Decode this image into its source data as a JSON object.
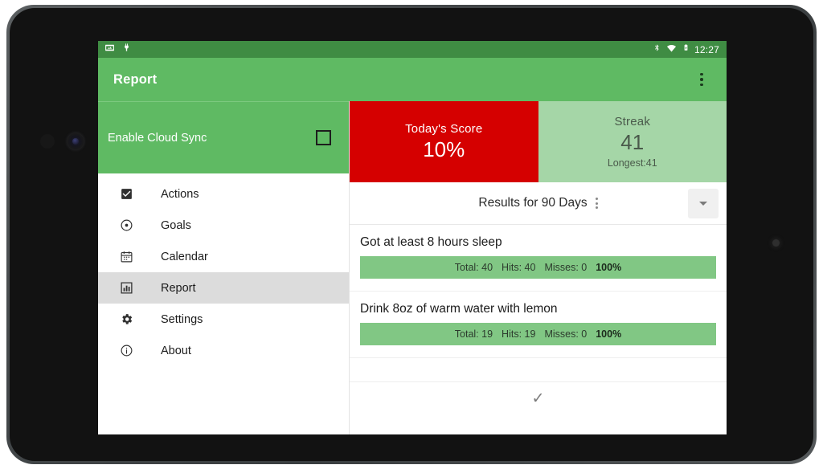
{
  "status_bar": {
    "left_icons": [
      "screenshot-icon",
      "usb-plug-icon"
    ],
    "right_icons": [
      "bluetooth-icon",
      "wifi-icon",
      "battery-charging-icon"
    ],
    "clock": "12:27"
  },
  "app_bar": {
    "title": "Report",
    "overflow_label": "overflow-menu"
  },
  "sidebar": {
    "cloud_sync": {
      "label": "Enable Cloud Sync",
      "checked": false
    },
    "items": [
      {
        "label": "Actions",
        "icon": "checkbox-checked-icon",
        "selected": false
      },
      {
        "label": "Goals",
        "icon": "target-icon",
        "selected": false
      },
      {
        "label": "Calendar",
        "icon": "calendar-icon",
        "selected": false
      },
      {
        "label": "Report",
        "icon": "bar-chart-icon",
        "selected": true
      },
      {
        "label": "Settings",
        "icon": "gear-icon",
        "selected": false
      },
      {
        "label": "About",
        "icon": "info-icon",
        "selected": false
      }
    ]
  },
  "score_cards": [
    {
      "title": "Today's Score",
      "value": "10%",
      "sub": ""
    },
    {
      "title": "Streak",
      "value": "41",
      "sub": "Longest:41"
    }
  ],
  "results": {
    "title": "Results for 90 Days",
    "dropdown_value": "90 Days"
  },
  "habits": [
    {
      "name": "Got at least 8 hours sleep",
      "total_label": "Total: 40",
      "hits_label": "Hits: 40",
      "misses_label": "Misses: 0",
      "percent": "100%"
    },
    {
      "name": "Drink 8oz of warm water with lemon",
      "total_label": "Total: 19",
      "hits_label": "Hits: 19",
      "misses_label": "Misses: 0",
      "percent": "100%"
    }
  ],
  "partial_row_check": "✓",
  "nav_bar": {
    "back": "back-button",
    "home": "home-button",
    "recents": "recents-button"
  },
  "colors": {
    "app_bar_green": "#5fba63",
    "status_bar_green": "#3f8c43",
    "score_red": "#d50000",
    "streak_green": "#a5d6a7",
    "progress_green": "#81c784",
    "selected_nav": "#dcdcdc"
  }
}
